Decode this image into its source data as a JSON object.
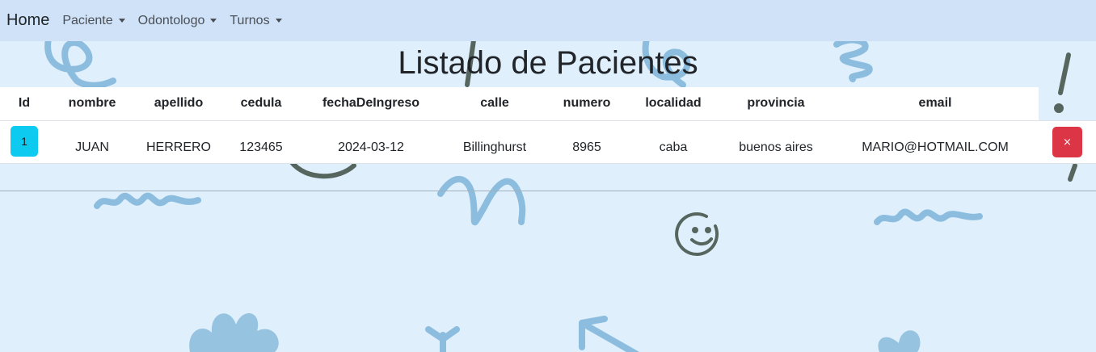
{
  "navbar": {
    "brand": "Home",
    "items": [
      {
        "label": "Paciente"
      },
      {
        "label": "Odontologo"
      },
      {
        "label": "Turnos"
      }
    ]
  },
  "page": {
    "title": "Listado de Pacientes"
  },
  "table": {
    "headers": [
      "Id",
      "nombre",
      "apellido",
      "cedula",
      "fechaDeIngreso",
      "calle",
      "numero",
      "localidad",
      "provincia",
      "email"
    ],
    "rows": [
      {
        "id": "1",
        "nombre": "JUAN",
        "apellido": "HERRERO",
        "cedula": "123465",
        "fechaDeIngreso": "2024-03-12",
        "calle": "Billinghurst",
        "numero": "8965",
        "localidad": "caba",
        "provincia": "buenos aires",
        "email": "MARIO@HOTMAIL.COM",
        "delete_label": "×"
      }
    ]
  },
  "colors": {
    "navbar_bg": "#cfe2f8",
    "page_bg": "#dfeffc",
    "info_button": "#0dcaf0",
    "danger_button": "#dc3545"
  }
}
